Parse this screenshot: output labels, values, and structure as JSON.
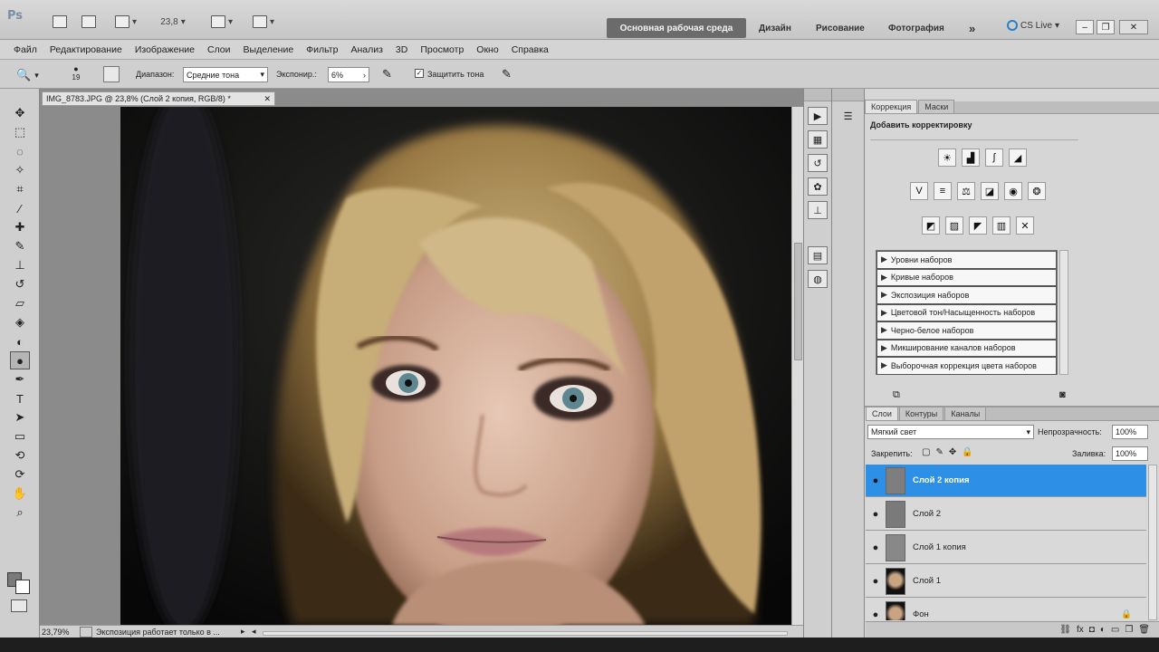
{
  "app": {
    "badge": "Ps",
    "zoom_field": "23,8",
    "workspaces": {
      "active": "Основная рабочая среда",
      "items": [
        "Дизайн",
        "Рисование",
        "Фотография"
      ],
      "more": "»"
    },
    "cslive": "CS Live"
  },
  "menu": [
    "Файл",
    "Редактирование",
    "Изображение",
    "Слои",
    "Выделение",
    "Фильтр",
    "Анализ",
    "3D",
    "Просмотр",
    "Окно",
    "Справка"
  ],
  "options": {
    "brush_size": "19",
    "range_label": "Диапазон:",
    "range_value": "Средние тона",
    "exposure_label": "Экспонир.:",
    "exposure_value": "6%",
    "protect_label": "Защитить тона"
  },
  "document": {
    "tab_title": "IMG_8783.JPG @ 23,8% (Слой 2 копия, RGB/8) *",
    "zoom_status": "23,79%",
    "status_text": "Экспозиция работает только в ..."
  },
  "adjustments": {
    "tabs": [
      "Коррекция",
      "Маски"
    ],
    "heading": "Добавить корректировку",
    "presets": [
      "Уровни наборов",
      "Кривые наборов",
      "Экспозиция наборов",
      "Цветовой тон/Насыщенность наборов",
      "Черно-белое наборов",
      "Микширование каналов наборов",
      "Выборочная коррекция цвета наборов"
    ]
  },
  "layers_panel": {
    "tabs": [
      "Слои",
      "Контуры",
      "Каналы"
    ],
    "blend_mode": "Мягкий свет",
    "opacity_label": "Непрозрачность:",
    "opacity_value": "100%",
    "lock_label": "Закрепить:",
    "fill_label": "Заливка:",
    "fill_value": "100%",
    "layers": [
      {
        "name": "Слой 2 копия",
        "selected": true
      },
      {
        "name": "Слой 2",
        "selected": false
      },
      {
        "name": "Слой 1 копия",
        "selected": false
      },
      {
        "name": "Слой 1",
        "selected": false
      },
      {
        "name": "Фон",
        "selected": false
      }
    ]
  },
  "colors": {
    "selection": "#2e8fe6",
    "panel_bg": "#d6d6d6",
    "workspace_active": "#6b6b6b"
  }
}
